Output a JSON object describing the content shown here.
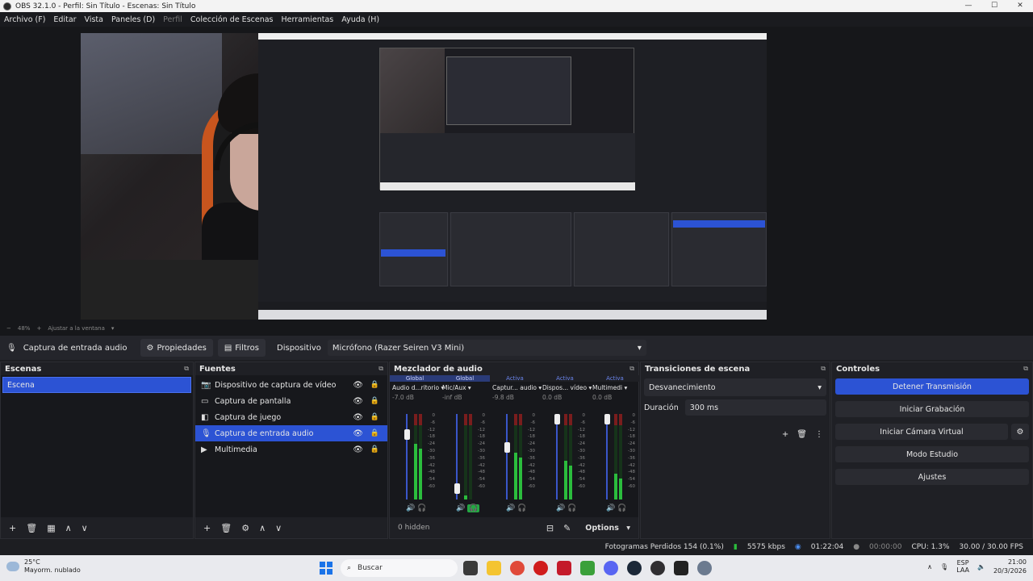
{
  "window": {
    "title": "OBS 32.1.0 - Perfil: Sin Título - Escenas: Sin Título"
  },
  "menu": [
    {
      "label": "Archivo (F)",
      "disabled": false
    },
    {
      "label": "Editar",
      "disabled": false
    },
    {
      "label": "Vista",
      "disabled": false
    },
    {
      "label": "Paneles (D)",
      "disabled": false
    },
    {
      "label": "Perfil",
      "disabled": true
    },
    {
      "label": "Colección de Escenas",
      "disabled": false
    },
    {
      "label": "Herramientas",
      "disabled": false
    },
    {
      "label": "Ayuda (H)",
      "disabled": false
    }
  ],
  "preview": {
    "zoom": "48%",
    "fit_label": "Ajustar a la ventana"
  },
  "source_toolbar": {
    "source_name": "Captura de entrada audio",
    "properties_label": "Propiedades",
    "filters_label": "Filtros",
    "device_label": "Dispositivo",
    "device_value": "Micrófono (Razer Seiren V3 Mini)"
  },
  "scenes": {
    "title": "Escenas",
    "items": [
      "Escena"
    ]
  },
  "sources": {
    "title": "Fuentes",
    "items": [
      {
        "label": "Dispositivo de captura de vídeo",
        "icon": "camera-icon"
      },
      {
        "label": "Captura de pantalla",
        "icon": "monitor-icon"
      },
      {
        "label": "Captura de juego",
        "icon": "gamepad-icon"
      },
      {
        "label": "Captura de entrada audio",
        "icon": "microphone-icon"
      },
      {
        "label": "Multimedia",
        "icon": "play-icon"
      }
    ],
    "selected_index": 3
  },
  "mixer": {
    "title": "Mezclador de audio",
    "channels": [
      {
        "status": "Global",
        "name": "Audio d...ritorio",
        "db": "-7.0 dB",
        "level": 0.65,
        "fader": 0.8,
        "monitor_on": false
      },
      {
        "status": "Global",
        "name": "Mic/Aux",
        "db": "-inf dB",
        "level": 0.05,
        "fader": 0.08,
        "monitor_on": true
      },
      {
        "status": "Activa",
        "name": "Captur... audio",
        "db": "-9.8 dB",
        "level": 0.55,
        "fader": 0.62,
        "monitor_on": false
      },
      {
        "status": "Activa",
        "name": "Dispos... vídeo",
        "db": "0.0 dB",
        "level": 0.45,
        "fader": 1.0,
        "monitor_on": false
      },
      {
        "status": "Activa",
        "name": "Multimedi",
        "db": "0.0 dB",
        "level": 0.3,
        "fader": 1.0,
        "monitor_on": false
      }
    ],
    "scale": [
      "0",
      "-6",
      "-12",
      "-18",
      "-24",
      "-30",
      "-36",
      "-42",
      "-48",
      "-54",
      "-60"
    ],
    "hidden_label": "0 hidden",
    "options_label": "Options"
  },
  "transitions": {
    "title": "Transiciones de escena",
    "selected": "Desvanecimiento",
    "duration_label": "Duración",
    "duration_value": "300 ms"
  },
  "controls": {
    "title": "Controles",
    "buttons": [
      {
        "label": "Detener Transmisión",
        "primary": true
      },
      {
        "label": "Iniciar Grabación",
        "primary": false
      },
      {
        "label": "Iniciar Cámara Virtual",
        "primary": false
      },
      {
        "label": "Modo Estudio",
        "primary": false
      },
      {
        "label": "Ajustes",
        "primary": false
      }
    ]
  },
  "status": {
    "dropped_frames": "Fotogramas Perdidos 154 (0.1%)",
    "bitrate": "5575 kbps",
    "stream_time": "01:22:04",
    "rec_time": "00:00:00",
    "cpu": "CPU: 1.3%",
    "fps": "30.00 / 30.00 FPS"
  },
  "taskbar": {
    "weather_temp": "25°C",
    "weather_desc": "Mayorm. nublado",
    "search_placeholder": "Buscar",
    "lang": "ESP",
    "lang2": "LAA",
    "time": "21:00",
    "date": "20/3/2026"
  },
  "colors": {
    "accent": "#2c53d4",
    "meter_green": "#2bbd3d",
    "bg": "#1d1e22"
  }
}
